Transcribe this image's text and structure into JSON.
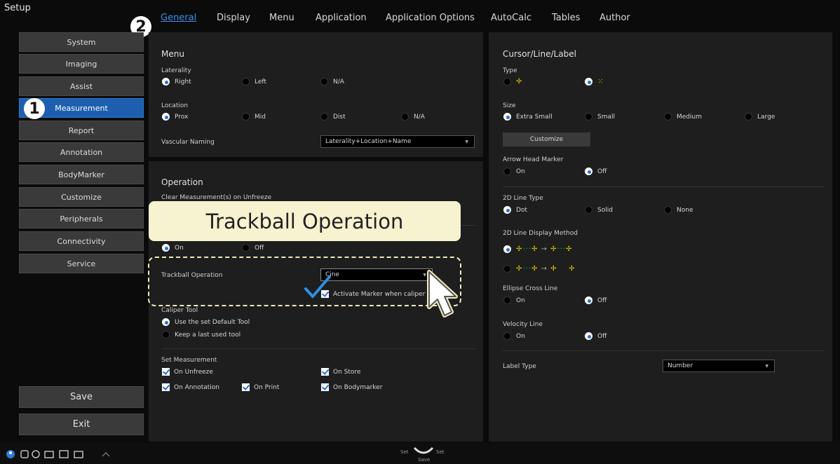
{
  "header": {
    "title": "Setup",
    "tabs": [
      {
        "label": "General",
        "active": true
      },
      {
        "label": "Display"
      },
      {
        "label": "Menu"
      },
      {
        "label": "Application"
      },
      {
        "label": "Application Options"
      },
      {
        "label": "AutoCalc"
      },
      {
        "label": "Tables"
      },
      {
        "label": "Author"
      }
    ]
  },
  "sidebar": {
    "items": [
      "System",
      "Imaging",
      "Assist",
      "Measurement",
      "Report",
      "Annotation",
      "BodyMarker",
      "Customize",
      "Peripherals",
      "Connectivity",
      "Service"
    ],
    "active_index": 3,
    "save_label": "Save",
    "exit_label": "Exit"
  },
  "badges": {
    "one": "1",
    "two": "2"
  },
  "callout": {
    "text": "Trackball Operation"
  },
  "menu_section": {
    "title": "Menu",
    "laterality": {
      "label": "Laterality",
      "options": [
        "Right",
        "Left",
        "N/A"
      ],
      "selected": "Right"
    },
    "location": {
      "label": "Location",
      "options": [
        "Prox",
        "Mid",
        "Dist",
        "N/A"
      ],
      "selected": "Prox"
    },
    "vascular_naming": {
      "label": "Vascular Naming",
      "value": "Laterality+Location+Name"
    }
  },
  "operation_section": {
    "title": "Operation",
    "clear_label": "Clear Measurement(s) on Unfreeze",
    "on_off": {
      "options": [
        "On",
        "Off"
      ],
      "selected": "On"
    },
    "trackball": {
      "label": "Trackball Operation",
      "value": "Cine",
      "activate_marker": "Activate Marker when caliper"
    },
    "caliper_tool": {
      "label": "Caliper Tool",
      "options": [
        "Use the set Default Tool",
        "Keep a last used tool"
      ],
      "selected": "Use the set Default Tool"
    },
    "set_measurement": {
      "label": "Set Measurement",
      "items": [
        "On Unfreeze",
        "On Store",
        "On Annotation",
        "On Print",
        "On Bodymarker"
      ]
    }
  },
  "cursor_section": {
    "title": "Cursor/Line/Label",
    "type_label": "Type",
    "size": {
      "label": "Size",
      "options": [
        "Extra Small",
        "Small",
        "Medium",
        "Large"
      ],
      "selected": "Extra Small"
    },
    "customize_label": "Customize",
    "arrow_head": {
      "label": "Arrow Head Marker",
      "options": [
        "On",
        "Off"
      ],
      "selected": "Off"
    },
    "line_type": {
      "label": "2D Line Type",
      "options": [
        "Dot",
        "Solid",
        "None"
      ],
      "selected": "Dot"
    },
    "line_display": {
      "label": "2D Line Display Method"
    },
    "ellipse": {
      "label": "Ellipse Cross Line",
      "options": [
        "On",
        "Off"
      ],
      "selected": "Off"
    },
    "velocity": {
      "label": "Velocity Line",
      "options": [
        "On",
        "Off"
      ],
      "selected": "Off"
    },
    "label_type": {
      "label": "Label Type",
      "value": "Number"
    }
  },
  "footer": {
    "set_left": "Set",
    "set_right": "Set",
    "save": "Save"
  },
  "colors": {
    "accent": "#2a72cc",
    "active_tab": "#3f8ee6",
    "highlight": "#f7f2cf"
  }
}
